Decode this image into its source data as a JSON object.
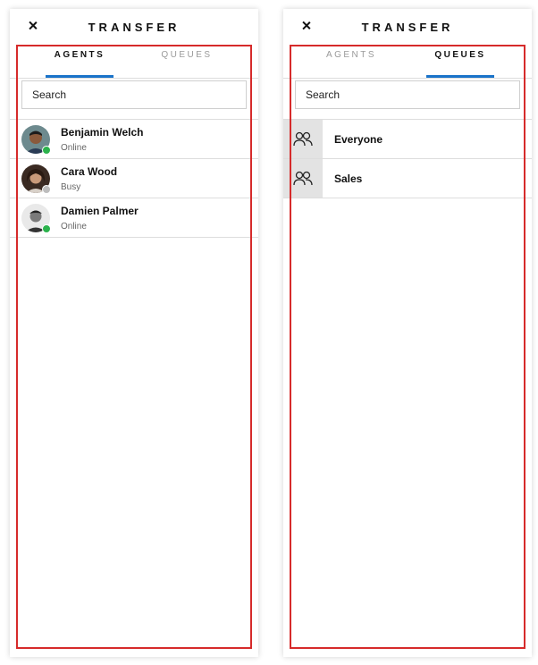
{
  "agents_panel": {
    "title": "TRANSFER",
    "tabs": [
      {
        "label": "AGENTS",
        "active": true
      },
      {
        "label": "QUEUES",
        "active": false
      }
    ],
    "search": {
      "placeholder": "Search"
    },
    "agents": [
      {
        "name": "Benjamin Welch",
        "status": "Online",
        "status_color": "#2bb24c"
      },
      {
        "name": "Cara Wood",
        "status": "Busy",
        "status_color": "#bdbdbd"
      },
      {
        "name": "Damien Palmer",
        "status": "Online",
        "status_color": "#2bb24c"
      }
    ]
  },
  "queues_panel": {
    "title": "TRANSFER",
    "tabs": [
      {
        "label": "AGENTS",
        "active": false
      },
      {
        "label": "QUEUES",
        "active": true
      }
    ],
    "search": {
      "placeholder": "Search"
    },
    "queues": [
      {
        "name": "Everyone",
        "icon": "group-icon"
      },
      {
        "name": "Sales",
        "icon": "group-icon"
      }
    ]
  },
  "colors": {
    "accent": "#1a73c9",
    "highlight": "#d62b2b",
    "online": "#2bb24c",
    "busy": "#bdbdbd"
  }
}
